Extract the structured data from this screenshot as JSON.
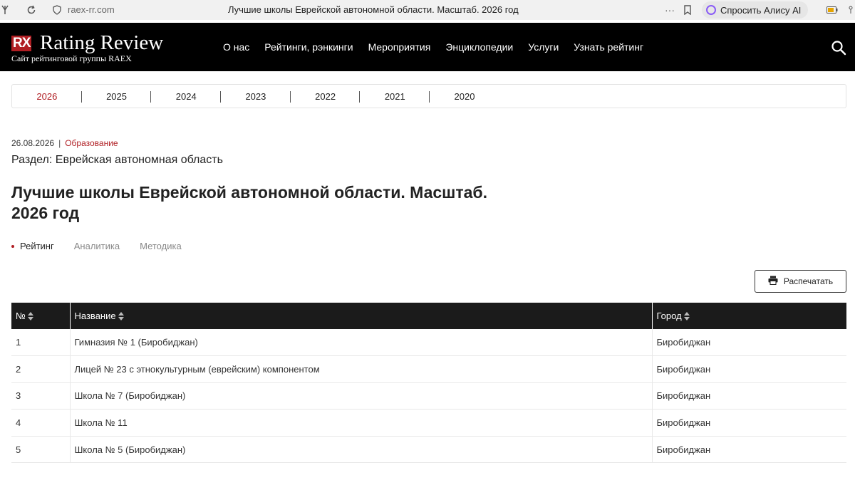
{
  "browser": {
    "url": "raex-rr.com",
    "title": "Лучшие школы Еврейской автономной области. Масштаб. 2026 год",
    "alice_label": "Спросить Алису AI",
    "menu_dots": "···"
  },
  "header": {
    "logo_mark": "RX",
    "logo_name": "Rating Review",
    "logo_subtitle": "Сайт рейтинговой группы RAEX",
    "nav": [
      "О нас",
      "Рейтинги, рэнкинги",
      "Мероприятия",
      "Энциклопедии",
      "Услуги",
      "Узнать рейтинг"
    ]
  },
  "years": {
    "items": [
      "2026",
      "2025",
      "2024",
      "2023",
      "2022",
      "2021",
      "2020"
    ],
    "active": "2026"
  },
  "meta": {
    "date": "26.08.2026",
    "separator": "|",
    "category": "Образование"
  },
  "section": "Раздел: Еврейская автономная область",
  "page_title": "Лучшие школы Еврейской автономной области. Масштаб. 2026 год",
  "subtabs": {
    "items": [
      "Рейтинг",
      "Аналитика",
      "Методика"
    ],
    "active": "Рейтинг"
  },
  "print_label": "Распечатать",
  "table": {
    "headers": [
      "№",
      "Название",
      "Город"
    ],
    "rows": [
      [
        "1",
        "Гимназия № 1 (Биробиджан)",
        "Биробиджан"
      ],
      [
        "2",
        "Лицей № 23 с этнокультурным (еврейским) компонентом",
        "Биробиджан"
      ],
      [
        "3",
        "Школа № 7 (Биробиджан)",
        "Биробиджан"
      ],
      [
        "4",
        "Школа № 11",
        "Биробиджан"
      ],
      [
        "5",
        "Школа № 5 (Биробиджан)",
        "Биробиджан"
      ]
    ]
  },
  "colors": {
    "accent": "#b01e23",
    "header_bg": "#000000",
    "table_header_bg": "#1b1b1b"
  }
}
